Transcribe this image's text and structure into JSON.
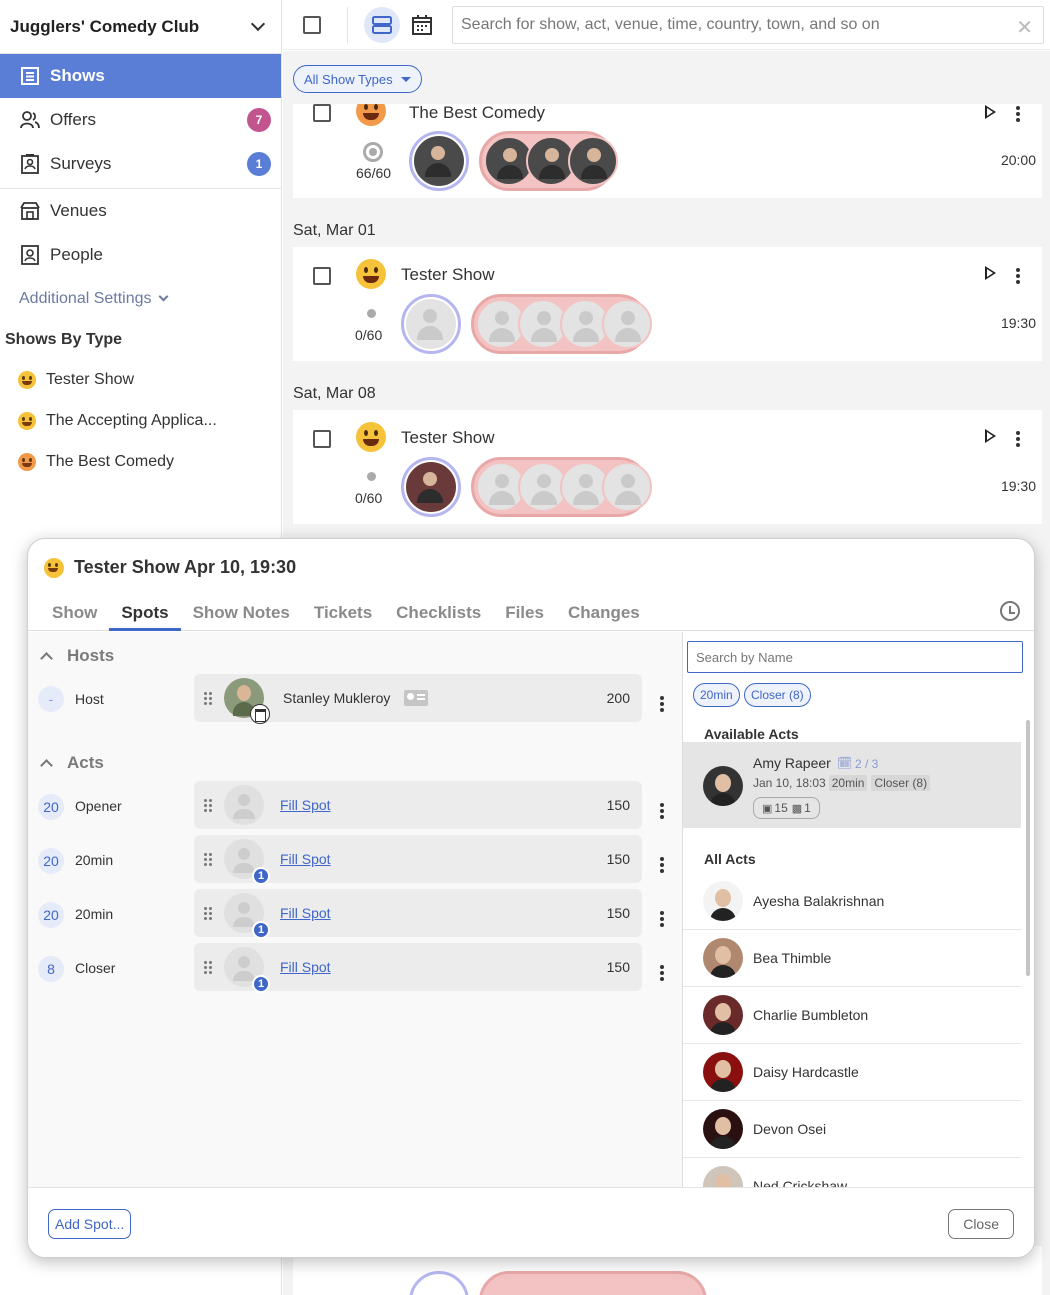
{
  "sidebar": {
    "club_name": "Jugglers' Comedy Club",
    "nav": [
      {
        "label": "Shows",
        "icon": "list-icon",
        "active": true
      },
      {
        "label": "Offers",
        "icon": "people-icon",
        "badge": "7",
        "badge_color": "#c2558e"
      },
      {
        "label": "Surveys",
        "icon": "survey-icon",
        "badge": "1",
        "badge_color": "#5a7ed6"
      },
      {
        "label": "Venues",
        "icon": "venue-icon"
      },
      {
        "label": "People",
        "icon": "person-card-icon"
      }
    ],
    "additional_settings": "Additional Settings",
    "shows_by_type_heading": "Shows By Type",
    "types": [
      "Tester Show",
      "The Accepting Applica...",
      "The Best Comedy"
    ]
  },
  "topbar": {
    "search_placeholder": "Search for show, act, venue, time, country, town, and so on"
  },
  "main": {
    "filter_label": "All Show Types",
    "cards": [
      {
        "title": "The Best Comedy",
        "capacity": "66/60",
        "time": "20:00"
      },
      {
        "date": "Sat, Mar 01",
        "title": "Tester Show",
        "capacity": "0/60",
        "time": "19:30"
      },
      {
        "date": "Sat, Mar 08",
        "title": "Tester Show",
        "capacity": "0/60",
        "time": "19:30"
      }
    ]
  },
  "modal": {
    "title": "Tester Show Apr 10, 19:30",
    "tabs": [
      "Show",
      "Spots",
      "Show Notes",
      "Tickets",
      "Checklists",
      "Files",
      "Changes"
    ],
    "active_tab": "Spots",
    "hosts_heading": "Hosts",
    "acts_heading": "Acts",
    "host_spot": {
      "num": "-",
      "label": "Host",
      "name": "Stanley Mukleroy",
      "fee": "200"
    },
    "act_spots": [
      {
        "num": "20",
        "label": "Opener",
        "link": "Fill Spot",
        "fee": "150",
        "badge": ""
      },
      {
        "num": "20",
        "label": "20min",
        "link": "Fill Spot",
        "fee": "150",
        "badge": "1"
      },
      {
        "num": "20",
        "label": "20min",
        "link": "Fill Spot",
        "fee": "150",
        "badge": "1"
      },
      {
        "num": "8",
        "label": "Closer",
        "link": "Fill Spot",
        "fee": "150",
        "badge": "1"
      }
    ],
    "search_placeholder": "Search by Name",
    "chips": [
      "20min",
      "Closer (8)"
    ],
    "available_heading": "Available Acts",
    "available": {
      "name": "Amy Rapeer",
      "count": "2 / 3",
      "when": "Jan 10, 18:03",
      "tags": [
        "20min",
        "Closer (8)"
      ],
      "stat1": "15",
      "stat2": "1"
    },
    "all_heading": "All Acts",
    "all_acts": [
      "Ayesha Balakrishnan",
      "Bea Thimble",
      "Charlie Bumbleton",
      "Daisy Hardcastle",
      "Devon Osei",
      "Ned Crickshaw"
    ],
    "add_spot": "Add Spot...",
    "close": "Close"
  },
  "colors": {
    "accent": "#3f66c8",
    "active_nav": "#5a7ed6"
  }
}
